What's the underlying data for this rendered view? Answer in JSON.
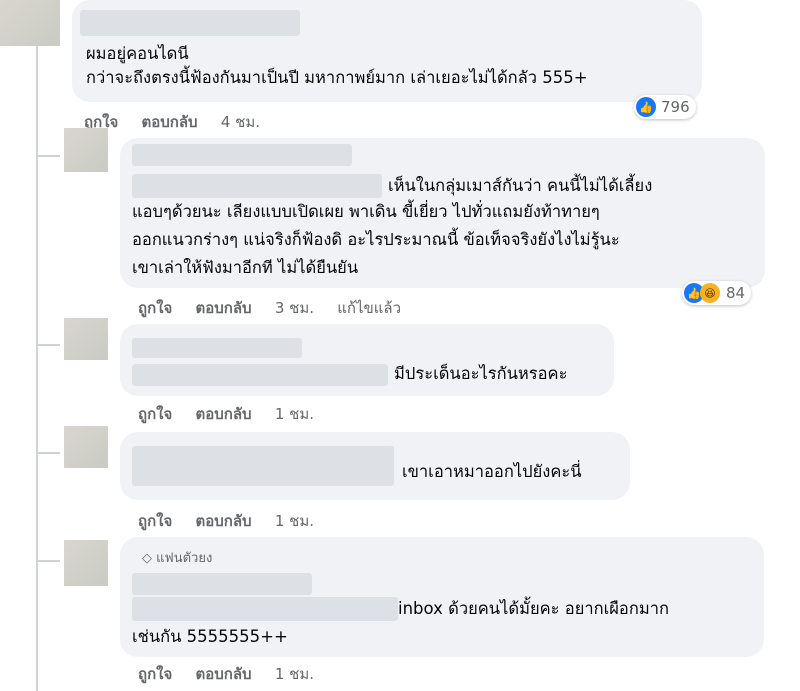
{
  "comments": [
    {
      "lines": [
        "ผมอยู่คอนไดนี",
        "กว่าจะถึงตรงนี้ฟ้องกันมาเป็นปี มหากาพย์มาก เล่าเยอะไม่ได้กลัว 555+"
      ],
      "actions": {
        "like": "ถูกใจ",
        "reply": "ตอบกลับ",
        "time": "4 ชม."
      },
      "reaction_count": "796"
    },
    {
      "lines": [
        "เห็นในกลุ่มเมาส์กันว่า คนนี้ไม่ได้เลี้ยง",
        "แอบๆด้วยนะ เลียงแบบเปิดเผย พาเดิน ขี้เยี่ยว ไปทั่วแถมยังท้าทายๆ",
        "ออกแนวกร่างๆ แน่จริงก็ฟ้องดิ อะไรประมาณนี้ ข้อเท็จจริงยังไงไม่รู้นะ",
        "เขาเล่าให้ฟังมาอีกที ไม่ได้ยืนยัน"
      ],
      "actions": {
        "like": "ถูกใจ",
        "reply": "ตอบกลับ",
        "time": "3 ชม.",
        "edited": "แก้ไขแล้ว"
      },
      "reaction_count": "84"
    },
    {
      "lines": [
        "มีประเด็นอะไรกันหรอคะ"
      ],
      "actions": {
        "like": "ถูกใจ",
        "reply": "ตอบกลับ",
        "time": "1 ชม."
      }
    },
    {
      "lines": [
        "เขาเอาหมาออกไปยังคะนี่"
      ],
      "actions": {
        "like": "ถูกใจ",
        "reply": "ตอบกลับ",
        "time": "1 ชม."
      }
    },
    {
      "badge": "แฟนตัวยง",
      "lines": [
        "inbox ด้วยคนได้มั้ยคะ อยากเผือกมาก",
        "เช่นกัน 5555555++"
      ],
      "actions": {
        "like": "ถูกใจ",
        "reply": "ตอบกลับ",
        "time": "1 ชม."
      }
    }
  ],
  "colors": {
    "bubble": "#f0f2f5",
    "meta": "#65676b",
    "like": "#1877f2",
    "haha": "#f7b125"
  }
}
